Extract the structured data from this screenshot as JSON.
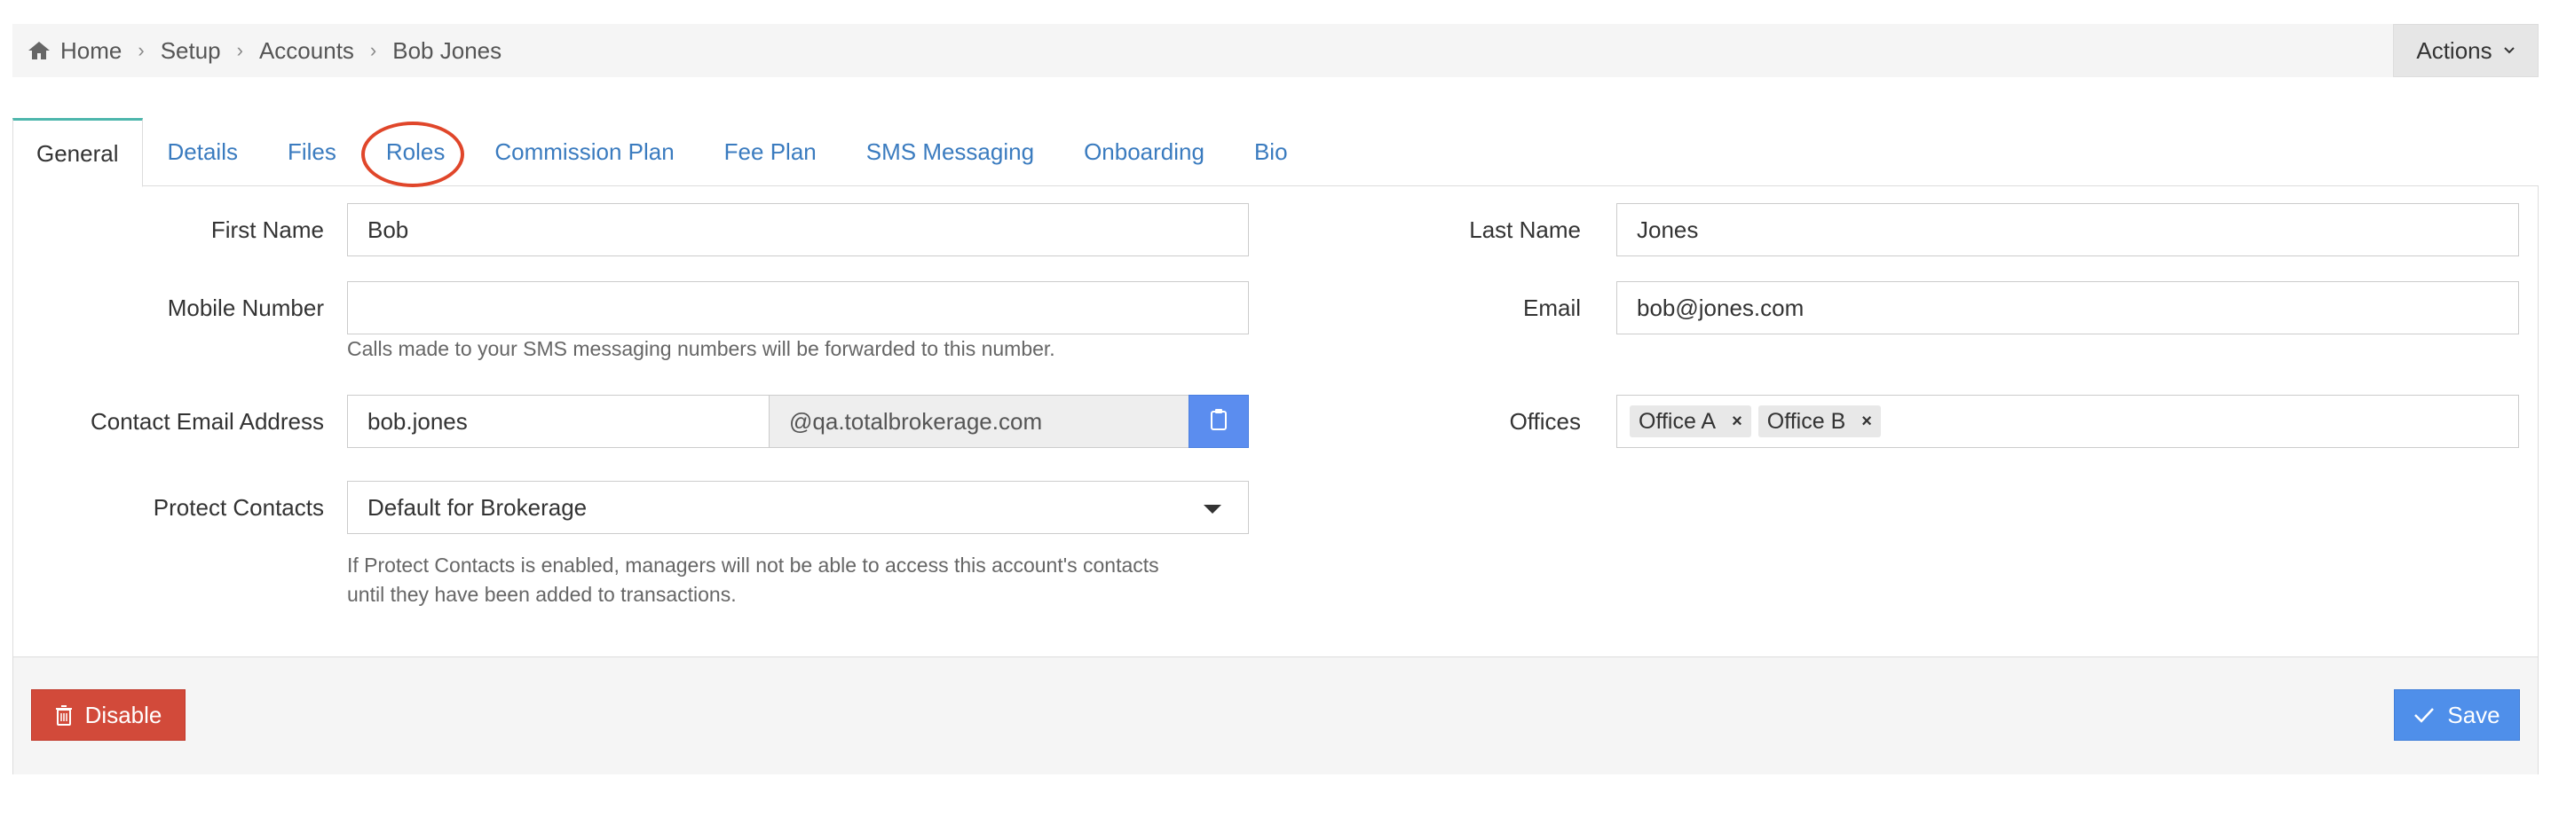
{
  "breadcrumb": {
    "home_icon": "home-icon",
    "items": [
      "Home",
      "Setup",
      "Accounts",
      "Bob Jones"
    ],
    "separator": "›"
  },
  "header": {
    "actions_label": "Actions"
  },
  "tabs": [
    {
      "label": "General",
      "active": true
    },
    {
      "label": "Details"
    },
    {
      "label": "Files"
    },
    {
      "label": "Roles",
      "circled": true
    },
    {
      "label": "Commission Plan"
    },
    {
      "label": "Fee Plan"
    },
    {
      "label": "SMS Messaging"
    },
    {
      "label": "Onboarding"
    },
    {
      "label": "Bio"
    }
  ],
  "form": {
    "first_name": {
      "label": "First Name",
      "value": "Bob"
    },
    "last_name": {
      "label": "Last Name",
      "value": "Jones"
    },
    "mobile_number": {
      "label": "Mobile Number",
      "value": "",
      "help": "Calls made to your SMS messaging numbers will be forwarded to this number."
    },
    "email": {
      "label": "Email",
      "value": "bob@jones.com"
    },
    "contact_email": {
      "label": "Contact Email Address",
      "value": "bob.jones",
      "domain": "@qa.totalbrokerage.com"
    },
    "offices": {
      "label": "Offices",
      "chips": [
        "Office A",
        "Office B"
      ],
      "remove_glyph": "×"
    },
    "protect_contacts": {
      "label": "Protect Contacts",
      "value": "Default for Brokerage",
      "help_line1": "If Protect Contacts is enabled, managers will not be able to access this account's contacts",
      "help_line2": "until they have been added to transactions."
    }
  },
  "footer": {
    "disable_label": "Disable",
    "save_label": "Save"
  },
  "colors": {
    "link": "#3a7bbf",
    "active_tab_accent": "#4db6ac",
    "highlight_circle": "#e0462a",
    "danger": "#d24a3a",
    "primary": "#4f8fea"
  }
}
